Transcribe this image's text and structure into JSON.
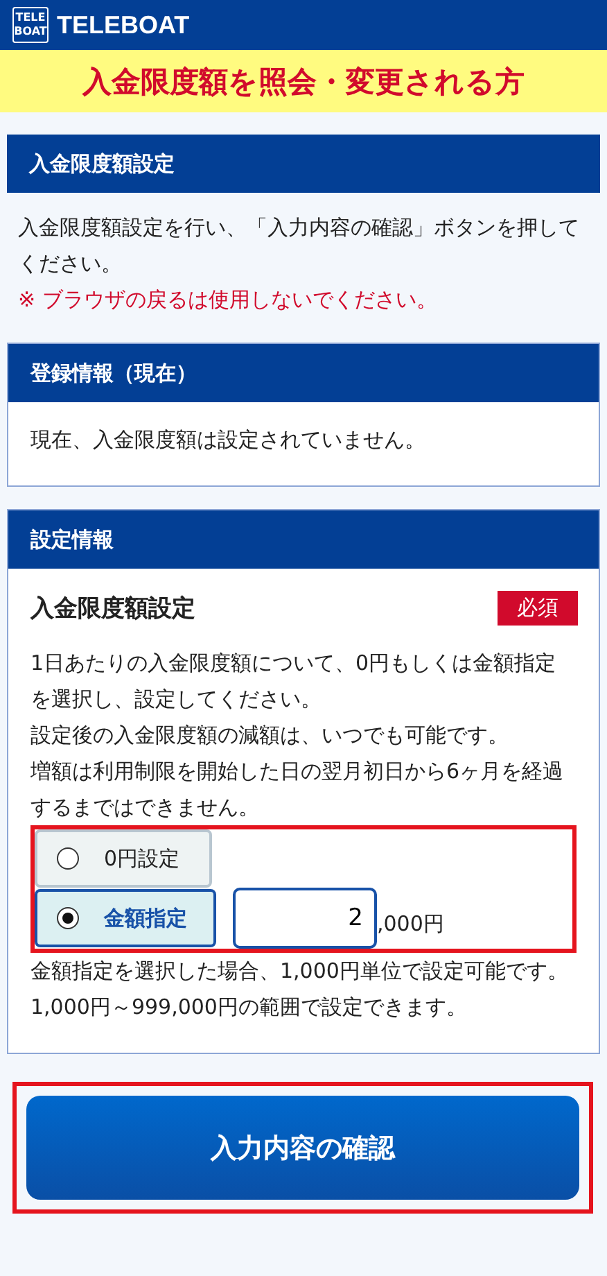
{
  "header": {
    "logo_top": "TELE",
    "logo_bottom": "BOAT",
    "brand": "TELEBOAT"
  },
  "banner": "入金限度額を照会・変更される方",
  "intro": {
    "title": "入金限度額設定",
    "text": "入金限度額設定を行い、「入力内容の確認」ボタンを押してください。",
    "warning": "※ ブラウザの戻るは使用しないでください。"
  },
  "current": {
    "title": "登録情報（現在）",
    "text": "現在、入金限度額は設定されていません。"
  },
  "settings": {
    "title": "設定情報",
    "field_label": "入金限度額設定",
    "required_badge": "必須",
    "description": [
      "1日あたりの入金限度額について、0円もしくは金額指定を選択し、設定してください。",
      "設定後の入金限度額の減額は、いつでも可能です。",
      "増額は利用制限を開始した日の翌月初日から6ヶ月を経過するまではできません。"
    ],
    "options": [
      {
        "label": "0円設定",
        "selected": false
      },
      {
        "label": "金額指定",
        "selected": true
      }
    ],
    "amount": {
      "value": "2",
      "suffix": ",000円"
    },
    "notes": [
      "金額指定を選択した場合、1,000円単位で設定可能です。",
      "1,000円～999,000円の範囲で設定できます。"
    ]
  },
  "confirm_button": "入力内容の確認"
}
